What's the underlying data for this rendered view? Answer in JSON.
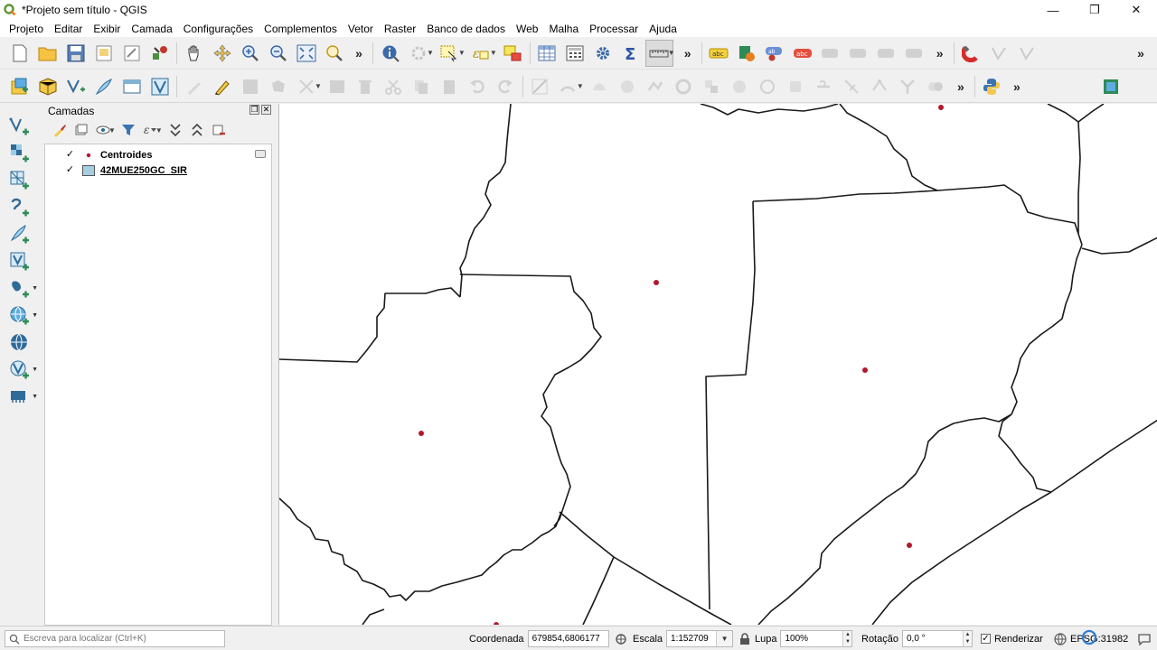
{
  "window": {
    "title": "*Projeto sem título - QGIS",
    "controls": {
      "minimize": "—",
      "restore": "❐",
      "close": "✕"
    }
  },
  "menu": [
    "Projeto",
    "Editar",
    "Exibir",
    "Camada",
    "Configurações",
    "Complementos",
    "Vetor",
    "Raster",
    "Banco de dados",
    "Web",
    "Malha",
    "Processar",
    "Ajuda"
  ],
  "toolbars": {
    "overflow": "»"
  },
  "layers_panel": {
    "title": "Camadas",
    "layers": [
      {
        "name": "Centroides",
        "checked": "✓",
        "symbol": "point",
        "color": "#b2182b"
      },
      {
        "name": "42MUE250GC_SIR",
        "checked": "✓",
        "symbol": "polygon",
        "color": "#a6cee3"
      }
    ]
  },
  "map": {
    "background": "#ffffff",
    "boundary_color": "#1a1a1a",
    "centroid_color": "#b2182b"
  },
  "statusbar": {
    "search_placeholder": "Escreva para localizar (Ctrl+K)",
    "coordinate_label": "Coordenada",
    "coordinate_value": "679854,6806177",
    "scale_label": "Escala",
    "scale_value": "1:152709",
    "magnifier_label": "Lupa",
    "magnifier_value": "100%",
    "rotation_label": "Rotação",
    "rotation_value": "0,0 °",
    "render_label": "Renderizar",
    "render_checked": "✓",
    "crs_value": "EPSG:31982"
  }
}
